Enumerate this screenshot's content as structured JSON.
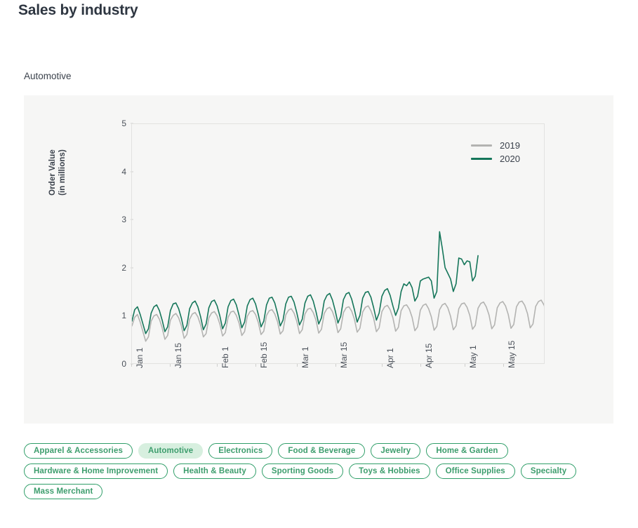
{
  "header": {
    "title": "Sales by industry"
  },
  "section": {
    "label": "Automotive"
  },
  "colors": {
    "line_2019": "#b3b3b1",
    "line_2020": "#15765a",
    "chip_border": "#2f9e68",
    "chip_text": "#3d9d6d",
    "chip_selected_bg": "#d7efdf",
    "panel_bg": "#f6f6f5",
    "title_text": "#2e3641"
  },
  "chart_data": {
    "type": "line",
    "title": "Automotive",
    "xlabel": "",
    "ylabel": "Order Value\n(in millions)",
    "ylabel_line1": "Order Value",
    "ylabel_line2": "(in millions)",
    "ylim": [
      0,
      5
    ],
    "yticks": [
      0,
      1,
      2,
      3,
      4,
      5
    ],
    "ytick_labels": [
      "0",
      "1",
      "2",
      "3",
      "4",
      "5"
    ],
    "grid": false,
    "legend_position": "top-right",
    "xtick_labels": [
      "Jan 1",
      "Jan 15",
      "Feb 1",
      "Feb 15",
      "Mar 1",
      "Mar 15",
      "Apr 1",
      "Apr 15",
      "May 1",
      "May 15"
    ],
    "xtick_positions": [
      0,
      14,
      31,
      45,
      60,
      74,
      91,
      105,
      121,
      135
    ],
    "x_range": [
      0,
      150
    ],
    "series": [
      {
        "name": "2019",
        "color": "#b3b3b1",
        "values": [
          0.78,
          0.96,
          1.02,
          0.86,
          0.66,
          0.46,
          0.55,
          0.88,
          0.99,
          1.02,
          0.92,
          0.74,
          0.5,
          0.58,
          0.9,
          1.0,
          1.04,
          0.95,
          0.78,
          0.52,
          0.6,
          0.92,
          1.03,
          1.06,
          0.97,
          0.8,
          0.55,
          0.62,
          0.95,
          1.05,
          1.08,
          0.99,
          0.82,
          0.57,
          0.64,
          0.96,
          1.07,
          1.09,
          1.0,
          0.84,
          0.58,
          0.66,
          0.98,
          1.08,
          1.1,
          1.02,
          0.85,
          0.6,
          0.67,
          1.0,
          1.1,
          1.12,
          1.03,
          0.87,
          0.61,
          0.68,
          1.01,
          1.11,
          1.14,
          1.05,
          0.88,
          0.62,
          0.7,
          1.03,
          1.13,
          1.15,
          1.06,
          0.9,
          0.63,
          0.71,
          1.04,
          1.14,
          1.17,
          1.08,
          0.91,
          0.64,
          0.72,
          1.06,
          1.16,
          1.18,
          1.09,
          0.92,
          0.65,
          0.73,
          1.07,
          1.17,
          1.2,
          1.1,
          0.94,
          0.66,
          0.74,
          1.08,
          1.18,
          1.21,
          1.12,
          0.95,
          0.67,
          0.75,
          1.1,
          1.2,
          1.22,
          1.13,
          0.96,
          0.68,
          0.76,
          1.11,
          1.21,
          1.24,
          1.14,
          0.97,
          0.69,
          0.77,
          1.12,
          1.22,
          1.25,
          1.16,
          0.98,
          0.7,
          0.78,
          1.14,
          1.24,
          1.26,
          1.17,
          1.0,
          0.71,
          0.79,
          1.15,
          1.25,
          1.28,
          1.18,
          1.01,
          0.72,
          0.8,
          1.16,
          1.26,
          1.29,
          1.2,
          1.02,
          0.73,
          0.81,
          1.18,
          1.28,
          1.3,
          1.21,
          1.04,
          0.74,
          0.82,
          1.19,
          1.29,
          1.32,
          1.22,
          1.05,
          0.75,
          1.3
        ]
      },
      {
        "name": "2020",
        "color": "#15765a",
        "values": [
          0.88,
          1.12,
          1.18,
          1.02,
          0.82,
          0.62,
          0.72,
          1.05,
          1.18,
          1.22,
          1.1,
          0.9,
          0.66,
          0.76,
          1.1,
          1.24,
          1.26,
          1.14,
          0.94,
          0.68,
          0.79,
          1.14,
          1.26,
          1.3,
          1.18,
          0.97,
          0.7,
          0.82,
          1.16,
          1.29,
          1.32,
          1.2,
          0.99,
          0.72,
          0.84,
          1.18,
          1.31,
          1.34,
          1.22,
          1.0,
          0.74,
          0.86,
          1.2,
          1.33,
          1.36,
          1.24,
          1.02,
          0.76,
          0.88,
          1.22,
          1.36,
          1.38,
          1.26,
          1.04,
          0.78,
          0.9,
          1.24,
          1.38,
          1.4,
          1.28,
          1.06,
          0.8,
          0.92,
          1.26,
          1.4,
          1.43,
          1.3,
          1.08,
          0.82,
          0.95,
          1.3,
          1.42,
          1.46,
          1.32,
          1.1,
          0.84,
          0.98,
          1.33,
          1.45,
          1.48,
          1.34,
          1.12,
          0.86,
          1.0,
          1.36,
          1.48,
          1.5,
          1.38,
          1.16,
          0.9,
          1.05,
          1.4,
          1.52,
          1.56,
          1.42,
          1.2,
          1.0,
          1.15,
          1.5,
          1.66,
          1.62,
          1.7,
          1.58,
          1.3,
          1.4,
          1.72,
          1.76,
          1.78,
          1.8,
          1.72,
          1.36,
          1.5,
          2.75,
          2.4,
          2.0,
          1.88,
          1.76,
          1.5,
          1.66,
          2.2,
          2.18,
          2.06,
          2.14,
          2.12,
          1.72,
          1.82,
          2.25
        ]
      }
    ],
    "legend": [
      {
        "label": "2019",
        "color": "#b3b3b1"
      },
      {
        "label": "2020",
        "color": "#15765a"
      }
    ]
  },
  "filters": {
    "rows": [
      [
        {
          "label": "Apparel & Accessories",
          "selected": false
        },
        {
          "label": "Automotive",
          "selected": true
        },
        {
          "label": "Electronics",
          "selected": false
        },
        {
          "label": "Food & Beverage",
          "selected": false
        },
        {
          "label": "Jewelry",
          "selected": false
        },
        {
          "label": "Home & Garden",
          "selected": false
        }
      ],
      [
        {
          "label": "Hardware & Home Improvement",
          "selected": false
        },
        {
          "label": "Health & Beauty",
          "selected": false
        },
        {
          "label": "Sporting Goods",
          "selected": false
        },
        {
          "label": "Toys & Hobbies",
          "selected": false
        },
        {
          "label": "Office Supplies",
          "selected": false
        },
        {
          "label": "Specialty",
          "selected": false
        }
      ],
      [
        {
          "label": "Mass Merchant",
          "selected": false
        }
      ]
    ]
  }
}
